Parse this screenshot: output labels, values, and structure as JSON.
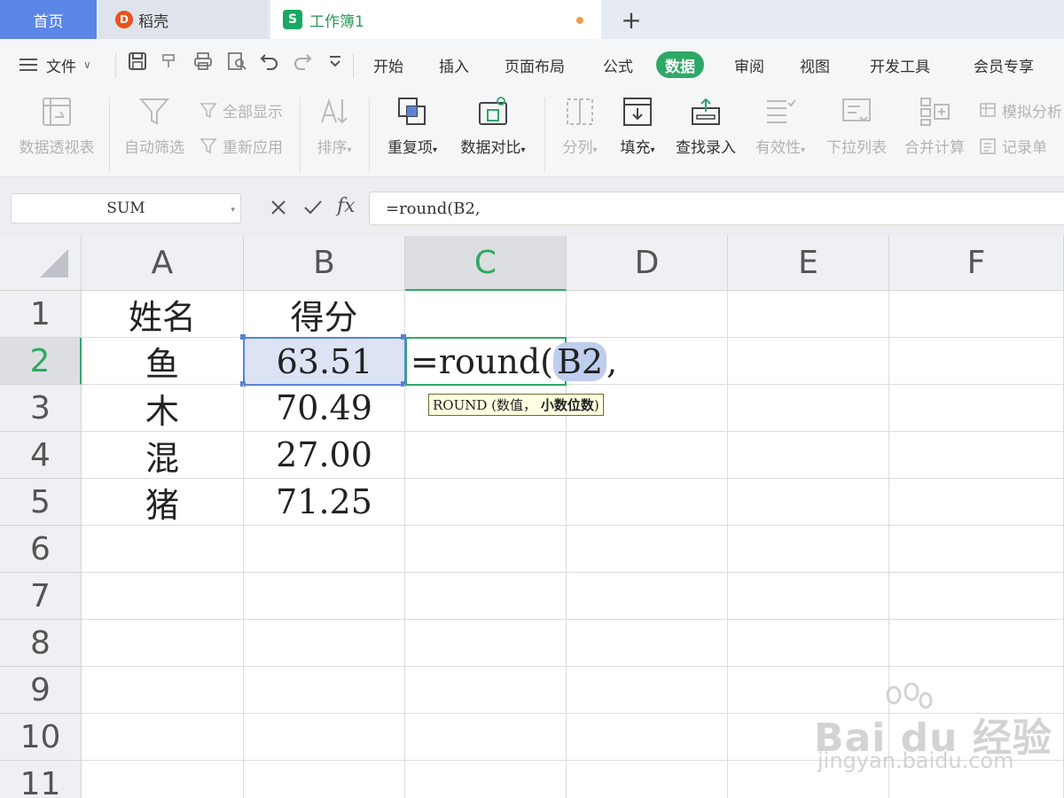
{
  "tabs": {
    "home": "首页",
    "daoke": "稻壳",
    "daoke_logo": "D",
    "workbook": "工作簿1",
    "workbook_logo": "S",
    "add": "+"
  },
  "menu": {
    "file": "文件",
    "items": [
      "开始",
      "插入",
      "页面布局",
      "公式",
      "数据",
      "审阅",
      "视图",
      "开发工具",
      "会员专享"
    ],
    "active": "数据"
  },
  "ribbon": {
    "pivot": "数据透视表",
    "autofilter": "自动筛选",
    "show_all": "全部显示",
    "reapply": "重新应用",
    "sort": "排序",
    "duplicates": "重复项",
    "compare": "数据对比",
    "split": "分列",
    "fill": "填充",
    "lookup_entry": "查找录入",
    "validity": "有效性",
    "dropdown_list": "下拉列表",
    "consolidate": "合并计算",
    "what_if": "模拟分析",
    "record_form": "记录单"
  },
  "formula_bar": {
    "name_box": "SUM",
    "fx": "fx",
    "formula": "=round(B2,"
  },
  "sheet": {
    "columns": [
      "A",
      "B",
      "C",
      "D",
      "E",
      "F"
    ],
    "rows": [
      "1",
      "2",
      "3",
      "4",
      "5",
      "6",
      "7",
      "8",
      "9",
      "10",
      "11"
    ],
    "headers": {
      "name": "姓名",
      "score": "得分"
    },
    "data": [
      {
        "name": "鱼",
        "score": "63.51"
      },
      {
        "name": "木",
        "score": "70.49"
      },
      {
        "name": "混",
        "score": "27.00"
      },
      {
        "name": "猪",
        "score": "71.25"
      }
    ],
    "editing_cell": {
      "prefix": "=round(",
      "ref": "B2",
      "suffix": ","
    },
    "tooltip": {
      "func": "ROUND",
      "args": "(数值，",
      "active_arg": "小数位数",
      "close": ")"
    }
  },
  "watermark": {
    "brand": "Bai du 经验",
    "url": "jingyan.baidu.com"
  },
  "colors": {
    "accent_green": "#2fa866",
    "selection_blue": "#5b82d6",
    "home_tab_blue": "#5b86e8"
  }
}
